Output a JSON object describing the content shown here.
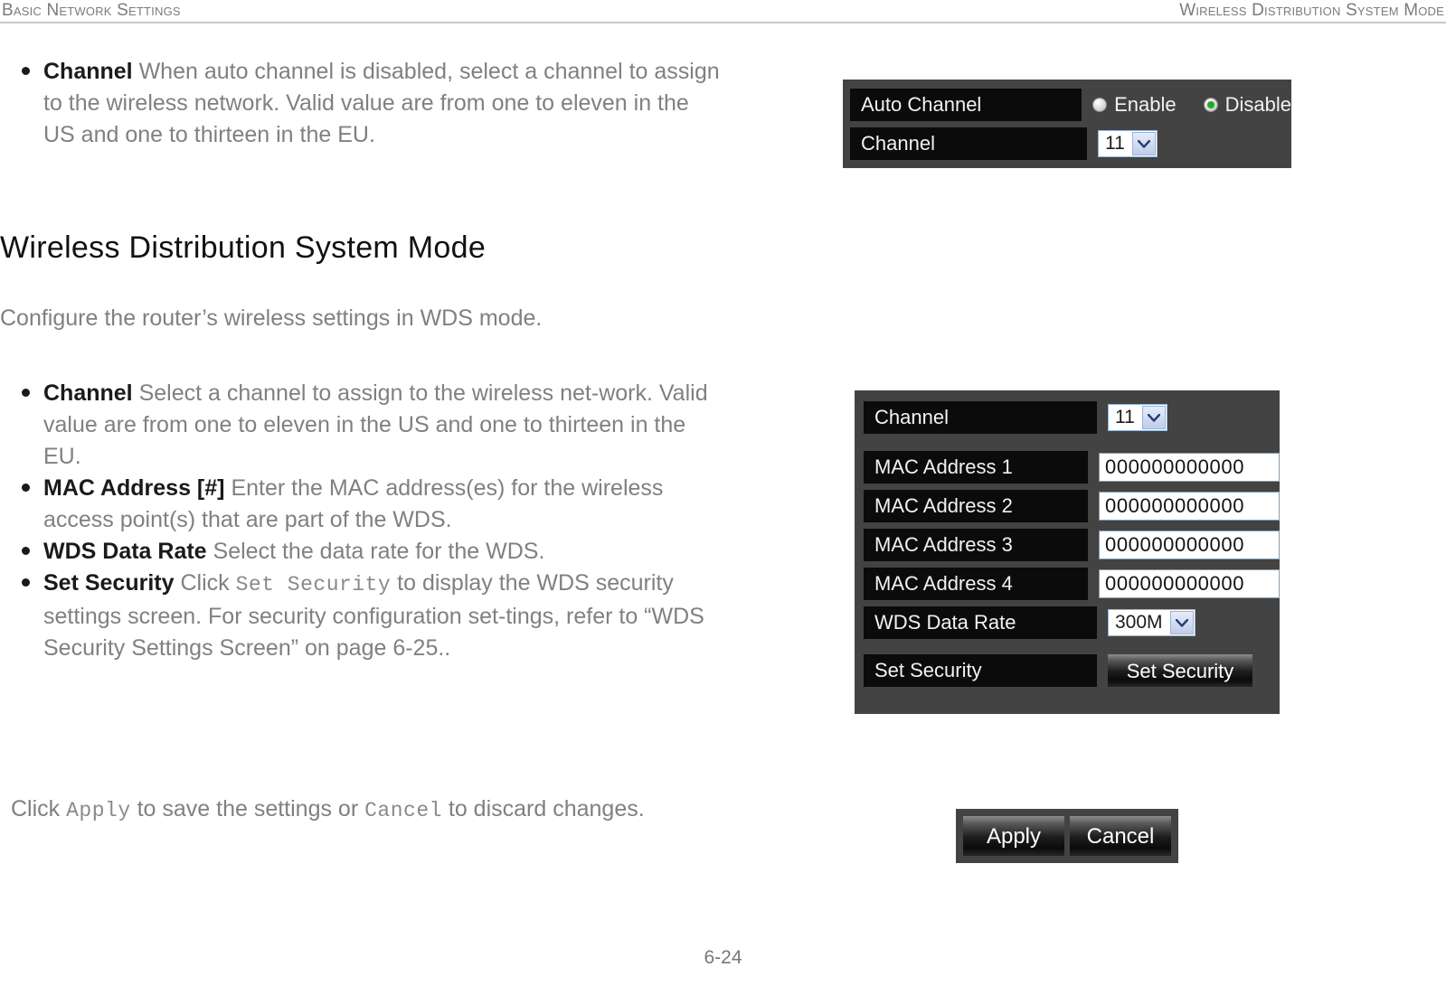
{
  "header": {
    "left": "Basic Network Settings",
    "right": "Wireless Distribution System Mode"
  },
  "page_number": "6-24",
  "top_bullet": {
    "term": "Channel",
    "text": " When auto channel is disabled, select a channel to assign to the wireless network. Valid value are from one to eleven in the US and one to thirteen in the EU."
  },
  "section": {
    "heading": "Wireless Distribution System Mode",
    "intro": "Configure the router’s wireless settings in WDS mode."
  },
  "bullets": [
    {
      "term": "Channel",
      "text": "  Select a channel to assign to the wireless net-work. Valid value are from one to eleven in the US and one to thirteen in the EU."
    },
    {
      "term": "MAC Address [#]",
      "text": "  Enter the MAC address(es) for the wireless access point(s) that are part of the WDS."
    },
    {
      "term": "WDS Data Rate",
      "text": "  Select the data rate for the WDS."
    },
    {
      "term": "Set Security",
      "text_before": "  Click ",
      "mono": "Set Security",
      "text_after": " to display the WDS security settings screen. For security configuration set-tings, refer to “WDS Security Settings Screen” on page 6-25.."
    }
  ],
  "closing": {
    "before": "Click ",
    "mono1": "Apply",
    "middle": " to save the settings or ",
    "mono2": "Cancel",
    "after": " to discard changes."
  },
  "panel_auto_channel": {
    "rows": [
      {
        "label": "Auto Channel"
      },
      {
        "label": "Channel"
      }
    ],
    "radios": [
      {
        "label": "Enable",
        "checked": false
      },
      {
        "label": "Disable",
        "checked": true
      }
    ],
    "channel_value": "11"
  },
  "panel_wds": {
    "channel_label": "Channel",
    "channel_value": "11",
    "mac_rows": [
      {
        "label": "MAC Address 1",
        "value": "000000000000"
      },
      {
        "label": "MAC Address 2",
        "value": "000000000000"
      },
      {
        "label": "MAC Address 3",
        "value": "000000000000"
      },
      {
        "label": "MAC Address 4",
        "value": "000000000000"
      }
    ],
    "data_rate_label": "WDS Data Rate",
    "data_rate_value": "300M",
    "set_security_label": "Set Security",
    "set_security_button": "Set Security"
  },
  "buttons": {
    "apply": "Apply",
    "cancel": "Cancel"
  },
  "colors": {
    "panel_bg": "#434343",
    "label_bg": "#0b0b0b",
    "radio_on": "#1faa2a",
    "body_text": "#808083",
    "term_text": "#1a1a1a"
  }
}
